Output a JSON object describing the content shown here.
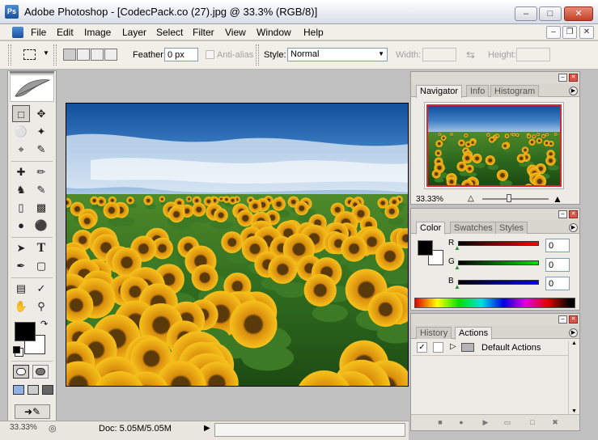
{
  "window": {
    "title": "Adobe Photoshop - [CodecPack.co (27).jpg @ 33.3% (RGB/8)]",
    "app_icon_text": "Ps"
  },
  "menu": {
    "items": [
      "File",
      "Edit",
      "Image",
      "Layer",
      "Select",
      "Filter",
      "View",
      "Window",
      "Help"
    ]
  },
  "options": {
    "feather_label": "Feather:",
    "feather_value": "0 px",
    "antialias_label": "Anti-alias",
    "style_label": "Style:",
    "style_value": "Normal",
    "width_label": "Width:",
    "height_label": "Height:"
  },
  "status": {
    "zoom": "33.33%",
    "doc": "Doc: 5.05M/5.05M"
  },
  "navigator": {
    "tabs": [
      "Navigator",
      "Info",
      "Histogram"
    ],
    "zoom": "33.33%",
    "slider_fraction": 0.4
  },
  "color": {
    "tabs": [
      "Color",
      "Swatches",
      "Styles"
    ],
    "r_label": "R",
    "g_label": "G",
    "b_label": "B",
    "r_value": "0",
    "g_value": "0",
    "b_value": "0"
  },
  "history": {
    "tabs": [
      "History",
      "Actions"
    ],
    "action_set": "Default Actions"
  },
  "colors": {
    "accent": "#2f6fc6",
    "sky": "#1e5fae",
    "foliage": "#2f6b1f",
    "sunflower": "#f2b915",
    "close": "#c3422a"
  }
}
